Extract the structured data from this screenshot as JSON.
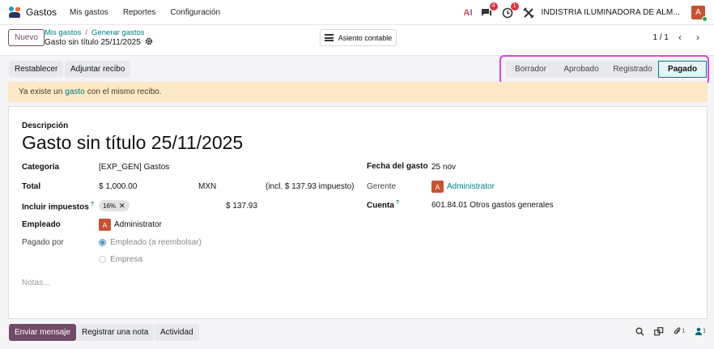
{
  "navbar": {
    "app_name": "Gastos",
    "menu": [
      "Mis gastos",
      "Reportes",
      "Configuración"
    ],
    "ai_label": "AI",
    "messages_badge": "4",
    "activity_badge": "1",
    "company": "INDISTRIA ILUMINADORA DE ALM...",
    "user_initial": "A"
  },
  "control": {
    "new_label": "Nuevo",
    "breadcrumb": [
      "Mis gastos",
      "Generar gastos"
    ],
    "breadcrumb_sep": "/",
    "record_title": "Gasto sin título 25/11/2025",
    "asiento_label": "Asiento contable",
    "pager": "1 / 1"
  },
  "statusbar": {
    "reset_label": "Restablecer",
    "attach_label": "Adjuntar recibo",
    "stages": [
      "Borrador",
      "Aprobado",
      "Registrado",
      "Pagado"
    ],
    "active_stage": "Pagado"
  },
  "warning": {
    "prefix": "Ya existe un",
    "link": "gasto",
    "suffix": "con el mismo recibo."
  },
  "form": {
    "description_label": "Descripción",
    "title": "Gasto sin título 25/11/2025",
    "category_label": "Categoría",
    "category_value": "[EXP_GEN] Gastos",
    "total_label": "Total",
    "total_value": "$ 1,000.00",
    "currency": "MXN",
    "tax_incl": "(incl. $ 137.93 impuesto)",
    "taxes_label": "Incluir impuestos",
    "tax_tag": "16%",
    "tax_amount": "$ 137.93",
    "employee_label": "Empleado",
    "employee_value": "Administrator",
    "employee_initial": "A",
    "paid_by_label": "Pagado por",
    "paid_by_options": [
      "Empleado (a reembolsar)",
      "Empresa"
    ],
    "paid_by_selected": "Empleado (a reembolsar)",
    "date_label": "Fecha del gasto",
    "date_value": "25 nov",
    "manager_label": "Gerente",
    "manager_value": "Administrator",
    "manager_initial": "A",
    "account_label": "Cuenta",
    "account_value": "601.84.01 Otros gastos generales",
    "help_mark": "?",
    "notes_placeholder": "Notas..."
  },
  "chatter": {
    "send_message": "Enviar mensaje",
    "log_note": "Registrar una nota",
    "activity": "Actividad",
    "attachments_count": "1",
    "followers_count": "1"
  },
  "colors": {
    "brand": "#714b67",
    "teal": "#017e84",
    "warning_bg": "#fde8c8",
    "avatar": "#c75233"
  }
}
